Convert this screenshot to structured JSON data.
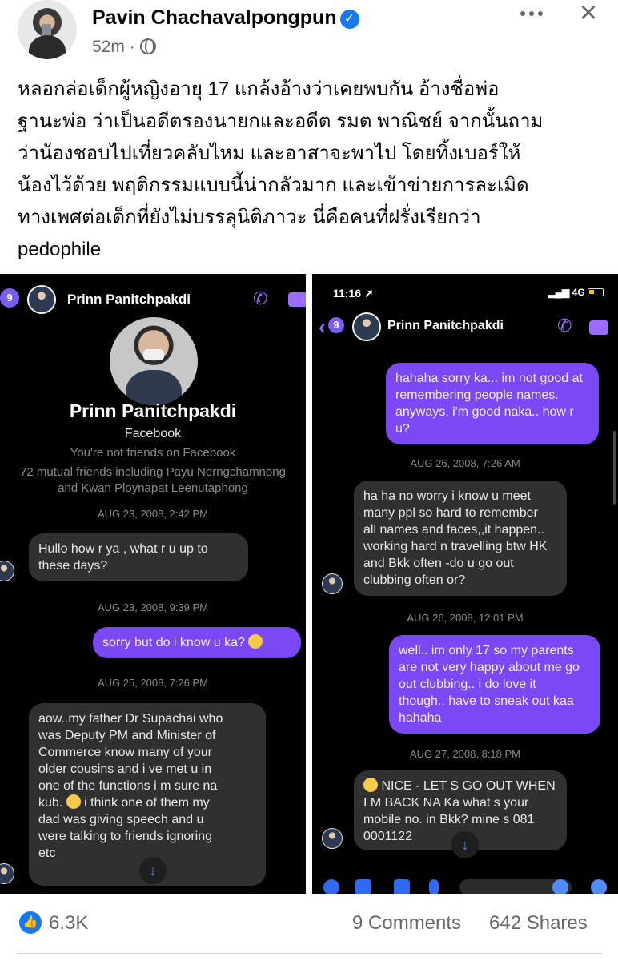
{
  "post": {
    "author": "Pavin Chachavalpongpun",
    "time": "52m",
    "separator": "·",
    "text": "หลอกล่อเด็กผู้หญิงอายุ 17 แกล้งอ้างว่าเคยพบกัน อ้างชื่อพ่อ\nฐานะพ่อ ว่าเป็นอดีตรองนายกและอดีต รมต พาณิชย์ จากนั้นถาม\nว่าน้องชอบไปเที่ยวคลับไหม และอาสาจะพาไป โดยทิ้งเบอร์ให้\nน้องไว้ด้วย พฤติกรรมแบบนี้น่ากลัวมาก และเข้าข่ายการละเมิด\nทางเพศต่อเด็กที่ยังไม่บรรลุนิติภาวะ นี่คือคนที่ฝรั่งเรียกว่า\npedophile"
  },
  "left_shot": {
    "badge": "9",
    "contact_name": "Prinn Panitchpakdi",
    "profile_name": "Prinn Panitchpakdi",
    "profile_sub": "Facebook",
    "not_friends": "You're not friends on Facebook",
    "mutual_1": "72 mutual friends including Payu Nerngchamnong",
    "mutual_2": "and Kwan Ploynapat Leenutaphong",
    "stamp_1": "AUG 23, 2008, 2:42 PM",
    "msg_1": "Hullo how r ya , what r u up to\nthese days?",
    "stamp_2": "AUG 23, 2008, 9:39 PM",
    "msg_2": "sorry but do i know u ka?",
    "stamp_3": "AUG 25, 2008, 7:26 PM",
    "msg_3a": "aow..my father Dr Supachai who\nwas Deputy PM and Minister of\nCommerce know many of your\nolder cousins and i ve met u in\none of the functions i m sure na\nkub.",
    "msg_3b": "i think one of them my\ndad was giving speech and u\nwere talking to friends ignoring\netc"
  },
  "right_shot": {
    "status_time": "11:16",
    "status_net": "4G",
    "badge": "9",
    "contact_name": "Prinn Panitchpakdi",
    "msg_1": "hahaha sorry ka... im not good at\nremembering people names.\nanyways, i'm good naka.. how r\nu?",
    "stamp_1": "AUG 26, 2008, 7:26 AM",
    "msg_2": "ha ha no worry i know u meet\nmany ppl so hard to remember\nall names and faces,,it happen..\nworking hard n travelling btw HK\nand Bkk often -do u go out\nclubbing often or?",
    "stamp_2": "AUG 26, 2008, 12:01 PM",
    "msg_3": "well.. im only 17 so my parents\nare not very happy about me go\nout clubbing.. i do love it\nthough.. have to sneak out kaa\nhahaha",
    "stamp_3": "AUG 27, 2008, 8:18 PM",
    "msg_4a": "NICE - LET S GO OUT WHEN",
    "msg_4b": "I M BACK NA Ka  what s your\nmobile no. in Bkk? mine s 081\n0001122"
  },
  "stats": {
    "likes": "6.3K",
    "comments": "9 Comments",
    "shares": "642 Shares"
  },
  "colors": {
    "facebook_blue": "#1877f2",
    "messenger_purple": "#7a48f5",
    "muted_text": "#65676b"
  }
}
